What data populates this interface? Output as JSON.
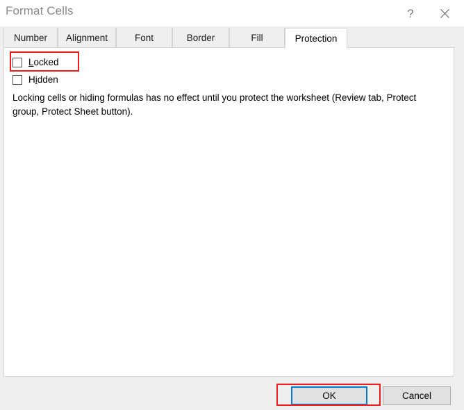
{
  "dialog": {
    "title": "Format Cells",
    "help_icon": "?",
    "help_icon_name": "help-icon",
    "close_icon_name": "close-icon"
  },
  "tabs": [
    {
      "label": "Number",
      "active": false
    },
    {
      "label": "Alignment",
      "active": false
    },
    {
      "label": "Font",
      "active": false
    },
    {
      "label": "Border",
      "active": false
    },
    {
      "label": "Fill",
      "active": false
    },
    {
      "label": "Protection",
      "active": true
    }
  ],
  "protection": {
    "checkboxes": [
      {
        "label": "Locked",
        "accel": "L",
        "checked": false
      },
      {
        "label": "Hidden",
        "accel": "i",
        "checked": false
      }
    ],
    "info_text": "Locking cells or hiding formulas has no effect until you protect the worksheet (Review tab, Protect group, Protect Sheet button)."
  },
  "footer": {
    "ok_label": "OK",
    "cancel_label": "Cancel"
  },
  "annotations": {
    "highlight_color": "#f01c1c",
    "focus_color": "#0078d7",
    "items": [
      {
        "target": "locked-checkbox"
      },
      {
        "target": "ok-button"
      }
    ]
  }
}
